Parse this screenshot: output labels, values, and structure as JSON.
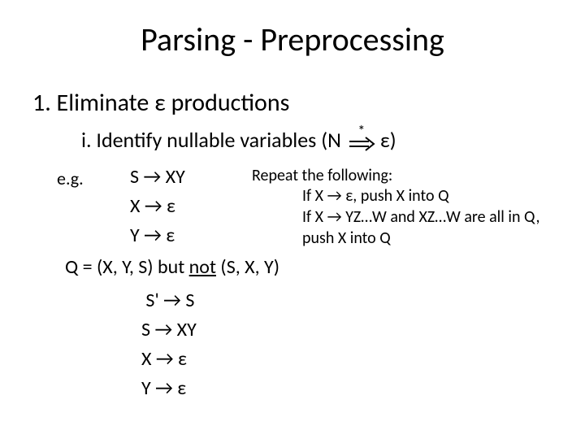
{
  "title": "Parsing - Preprocessing",
  "step1": "1.  Eliminate ε productions",
  "identify": {
    "prefix": "i. Identify nullable variables (N",
    "star": "*",
    "suffix": " ε)"
  },
  "eg": "e.g.",
  "productions1": {
    "l1": "S → XY",
    "l2": "X → ε",
    "l3": "Y → ε"
  },
  "qline": {
    "pre": "Q = (X, Y, S) but ",
    "not": "not",
    "post": " (S, X, Y)"
  },
  "productions2": {
    "l1": " S' → S",
    "l2": "S → XY",
    "l3": "X → ε",
    "l4": "Y → ε"
  },
  "repeat": {
    "head": "Repeat the following:",
    "b1": "If X → ε, push X into Q",
    "b2": "If X → YZ…W and XZ…W are all in Q,",
    "b3": "push X into Q"
  }
}
